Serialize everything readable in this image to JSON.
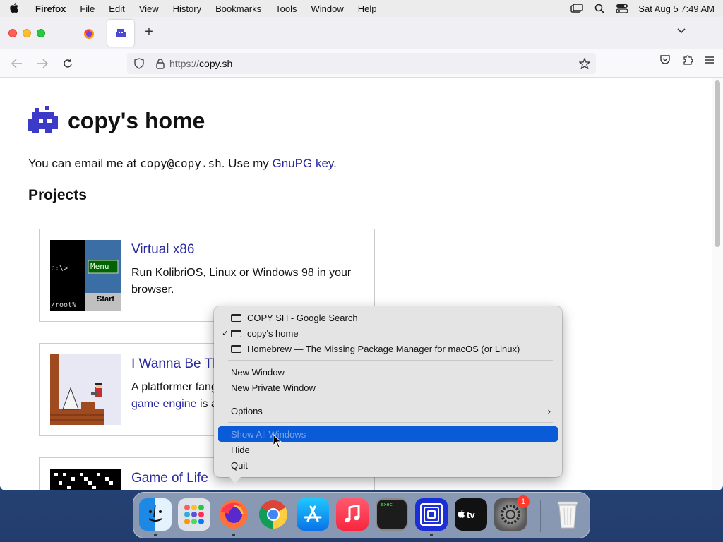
{
  "menubar": {
    "app_name": "Firefox",
    "items": [
      "File",
      "Edit",
      "View",
      "History",
      "Bookmarks",
      "Tools",
      "Window",
      "Help"
    ],
    "clock": "Sat Aug 5  7:49 AM"
  },
  "browser": {
    "url_scheme": "https://",
    "url_host": "copy.sh",
    "new_tab_symbol": "+"
  },
  "page": {
    "title": "copy's home",
    "intro_prefix": "You can email me at ",
    "email": "copy@copy.sh",
    "intro_mid": ". Use my ",
    "gpg_link": "GnuPG key",
    "intro_suffix": ".",
    "projects_heading": "Projects",
    "projects": [
      {
        "title": "Virtual x86",
        "description": "Run KolibriOS, Linux or Windows 98 in your browser."
      },
      {
        "title": "I Wanna Be Th",
        "description_line1": "A platformer fang",
        "description_link": "game engine",
        "description_line2_suffix": " is a"
      },
      {
        "title": "Game of Life"
      }
    ],
    "thumb_x86": {
      "prompt": "c:\\>_",
      "menu": "Menu",
      "root": "/root%",
      "start": "Start"
    }
  },
  "context_menu": {
    "windows": [
      {
        "label": "COPY SH - Google Search",
        "checked": false
      },
      {
        "label": "copy's home",
        "checked": true
      },
      {
        "label": "Homebrew — The Missing Package Manager for macOS (or Linux)",
        "checked": false
      }
    ],
    "new_window": "New Window",
    "new_private_window": "New Private Window",
    "options": "Options",
    "show_all_windows": "Show All Windows",
    "hide": "Hide",
    "quit": "Quit",
    "check_mark": "✓",
    "submenu_arrow": "›"
  },
  "dock": {
    "settings_badge": "1",
    "terminal_label": "exec"
  }
}
